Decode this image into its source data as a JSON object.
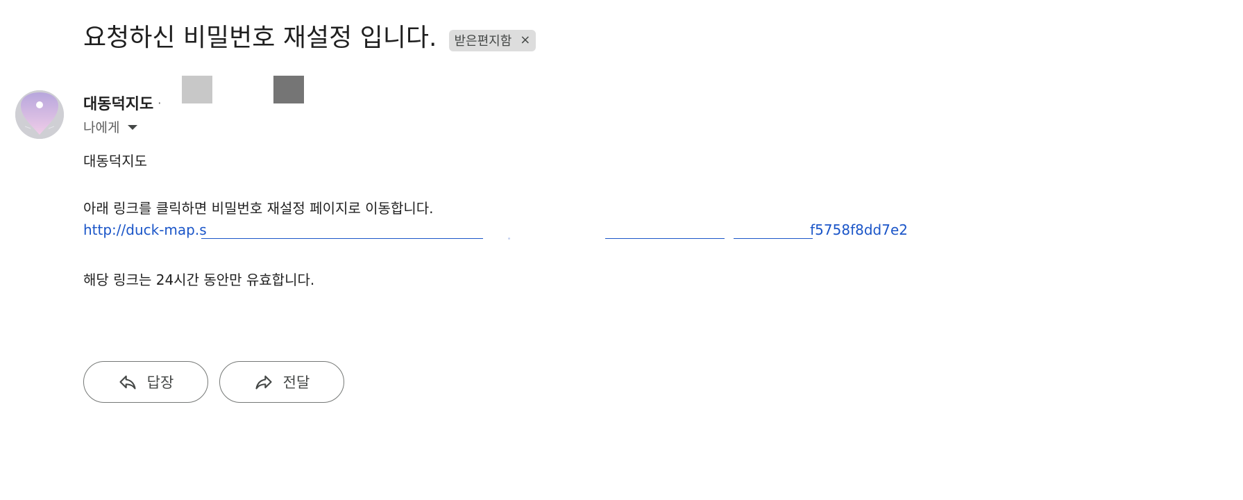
{
  "email": {
    "subject": "요청하신 비밀번호 재설정 입니다.",
    "label_chip": {
      "label": "받은편지함",
      "close_glyph": "×"
    }
  },
  "sender": {
    "name": "대동덕지도",
    "separator": "·",
    "avatar_icon": "location-pin-icon",
    "recipient_text": "나에게"
  },
  "body": {
    "greeting": "대동덕지도",
    "instruction": "아래 링크를 클릭하면 비밀번호 재설정 페이지로 이동합니다.",
    "link_start": "http://duck-map.s",
    "link_end": "f5758f8dd7e2",
    "validity": "해당 링크는 24시간 동안만 유효합니다."
  },
  "actions": {
    "reply_label": "답장",
    "reply_icon": "reply-arrow-icon",
    "forward_label": "전달",
    "forward_icon": "forward-arrow-icon"
  },
  "colors": {
    "link": "#1a55c8",
    "chip_bg": "#dddddd",
    "button_border": "#747775"
  }
}
